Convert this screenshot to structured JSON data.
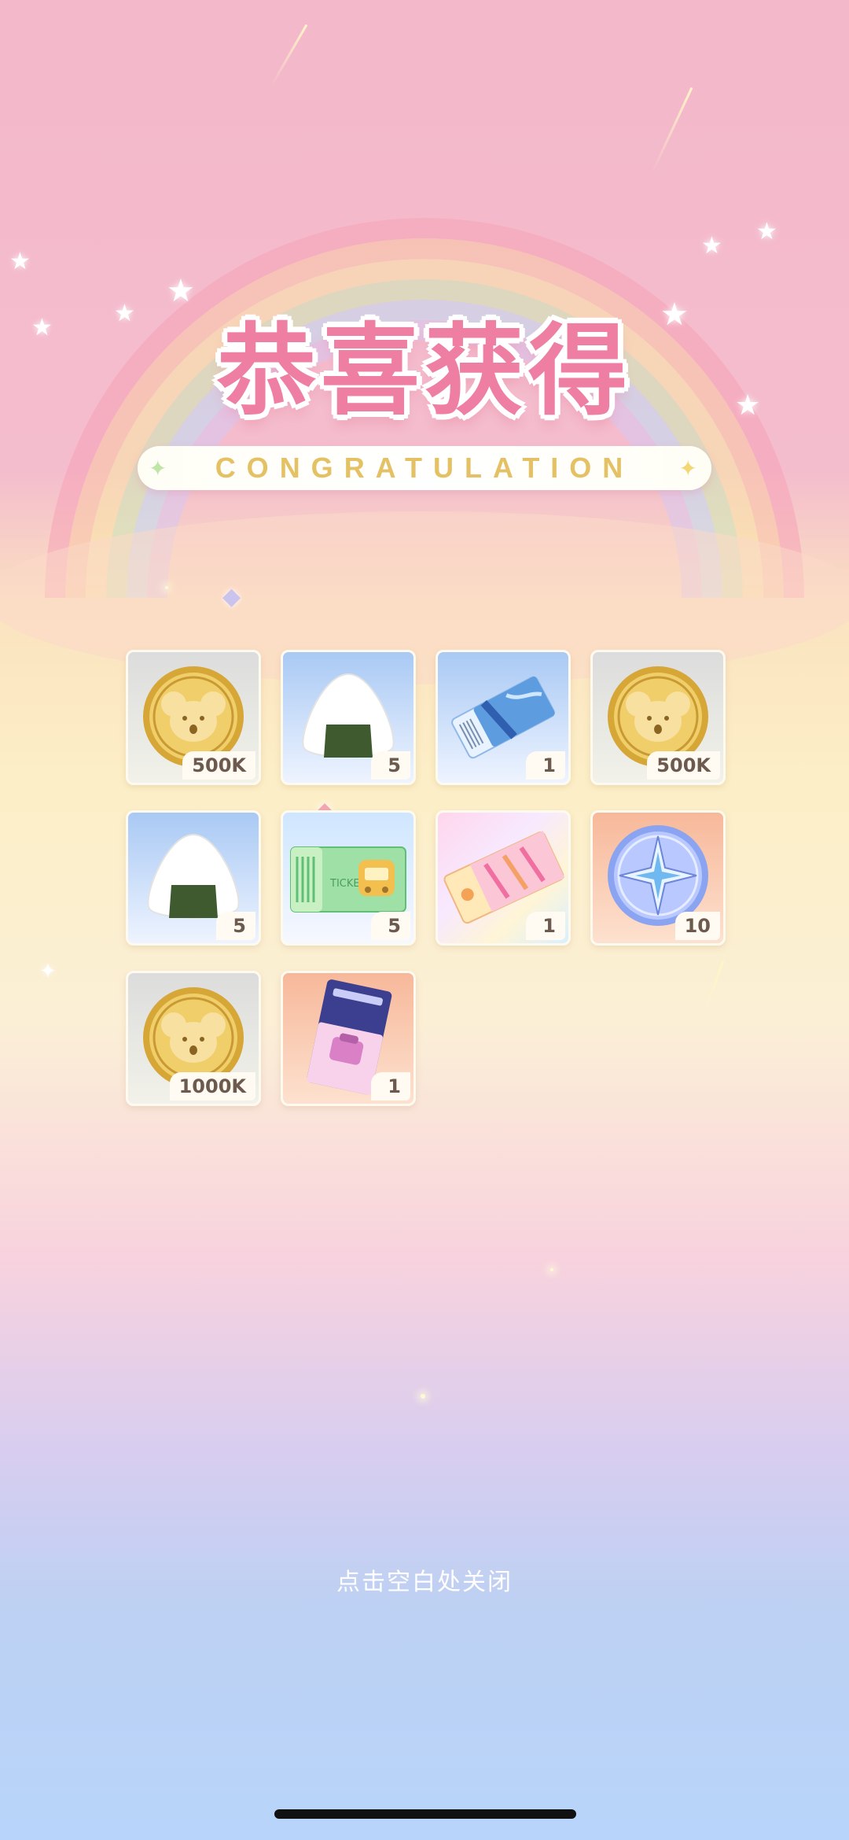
{
  "header": {
    "title": "恭喜获得",
    "subtitle": "CONGRATULATION"
  },
  "rewards": [
    {
      "icon": "koala-coin-icon",
      "quantity": "500K",
      "bg": "gray"
    },
    {
      "icon": "rice-ball-icon",
      "quantity": "5",
      "bg": "blue"
    },
    {
      "icon": "blue-ticket-icon",
      "quantity": "1",
      "bg": "blue"
    },
    {
      "icon": "koala-coin-icon",
      "quantity": "500K",
      "bg": "gray"
    },
    {
      "icon": "rice-ball-icon",
      "quantity": "5",
      "bg": "blue"
    },
    {
      "icon": "green-ticket-icon",
      "quantity": "5",
      "bg": "blue"
    },
    {
      "icon": "holo-ticket-icon",
      "quantity": "1",
      "bg": "holo"
    },
    {
      "icon": "compass-medal-icon",
      "quantity": "10",
      "bg": "orange"
    },
    {
      "icon": "koala-coin-icon",
      "quantity": "1000K",
      "bg": "gray"
    },
    {
      "icon": "purple-pass-icon",
      "quantity": "1",
      "bg": "orange"
    }
  ],
  "ticket_label": "TICKET",
  "close_hint": "点击空白处关闭",
  "colors": {
    "title": "#ee7fa3",
    "subtitle": "#e4c164",
    "quantity_text": "#6b5a4d"
  }
}
